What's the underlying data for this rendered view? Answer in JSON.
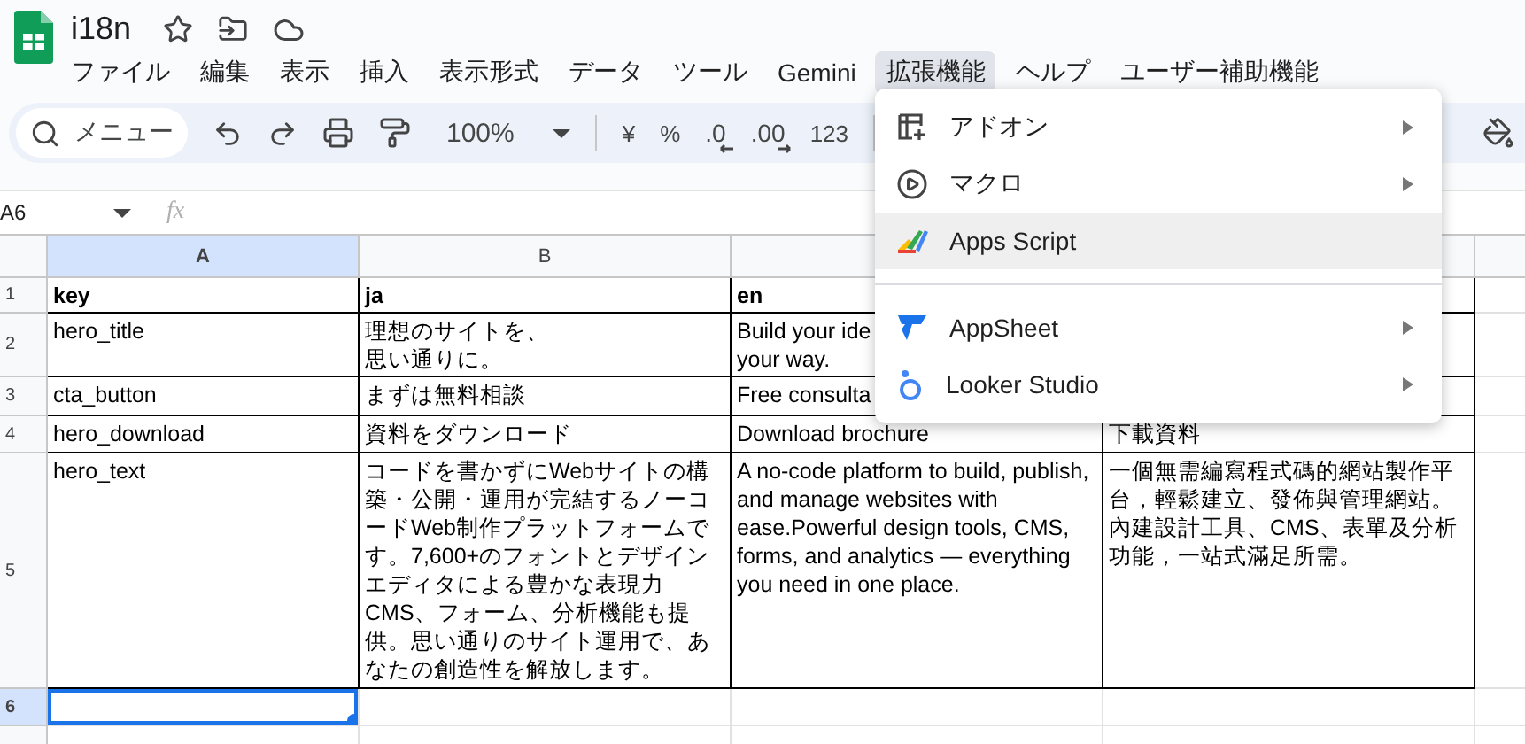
{
  "app": {
    "title": "i18n"
  },
  "menu_bar": [
    {
      "label": "ファイル",
      "selected": false
    },
    {
      "label": "編集",
      "selected": false
    },
    {
      "label": "表示",
      "selected": false
    },
    {
      "label": "挿入",
      "selected": false
    },
    {
      "label": "表示形式",
      "selected": false
    },
    {
      "label": "データ",
      "selected": false
    },
    {
      "label": "ツール",
      "selected": false
    },
    {
      "label": "Gemini",
      "selected": false
    },
    {
      "label": "拡張機能",
      "selected": true
    },
    {
      "label": "ヘルプ",
      "selected": false
    },
    {
      "label": "ユーザー補助機能",
      "selected": false
    }
  ],
  "toolbar": {
    "search": {
      "placeholder": "メニュー"
    },
    "zoom": "100%",
    "format_buttons": [
      {
        "label": "¥",
        "kind": "plain"
      },
      {
        "label": "%",
        "kind": "plain"
      },
      {
        "label": ".0",
        "kind": "decrease"
      },
      {
        "label": ".00",
        "kind": "increase"
      },
      {
        "label": "123",
        "kind": "plain"
      }
    ]
  },
  "name_box": "A6",
  "formula_label": "fx",
  "columns": [
    {
      "label": "A",
      "selected": true
    },
    {
      "label": "B",
      "selected": false
    },
    {
      "selected": false
    },
    {
      "selected": false
    }
  ],
  "rows": [
    {
      "number": "1",
      "bold": true,
      "selected": false,
      "cells": [
        "key",
        "ja",
        "en",
        null
      ]
    },
    {
      "number": "2",
      "bold": false,
      "selected": false,
      "cells": [
        "hero_title",
        [
          "理想のサイトを、",
          "思い通りに。"
        ],
        [
          "Build your ide",
          "your way."
        ],
        null
      ]
    },
    {
      "number": "3",
      "bold": false,
      "selected": false,
      "cells": [
        "cta_button",
        "まずは無料相談",
        "Free consulta",
        null
      ]
    },
    {
      "number": "4",
      "bold": false,
      "selected": false,
      "cells": [
        "hero_download",
        "資料をダウンロード",
        "Download brochure",
        "下載資料"
      ]
    },
    {
      "number": "5",
      "bold": false,
      "selected": false,
      "cells": [
        "hero_text",
        "コードを書かずにWebサイトの構築・公開・運用が完結するノーコードWeb制作プラットフォームです。7,600+のフォントとデザインエディタによる豊かな表現力CMS、フォーム、分析機能も提供。思い通りのサイト運用で、あなたの創造性を解放します。",
        "A no-code platform to build, publish, and manage websites with ease.Powerful design tools, CMS, forms, and analytics — everything you need in one place.",
        "一個無需編寫程式碼的網站製作平台，輕鬆建立、發佈與管理網站。內建設計工具、CMS、表單及分析功能，一站式滿足所需。"
      ]
    },
    {
      "number": "6",
      "bold": false,
      "selected": true,
      "cells": [
        null,
        null,
        null,
        null
      ]
    }
  ],
  "dropdown": {
    "groups": [
      [
        {
          "label": "アドオン",
          "kind": "addon",
          "submenu": true,
          "highlighted": false
        },
        {
          "label": "マクロ",
          "kind": "macro",
          "submenu": true,
          "highlighted": false
        },
        {
          "label": "Apps Script",
          "kind": "script",
          "submenu": false,
          "highlighted": true
        }
      ],
      [
        {
          "label": "AppSheet",
          "kind": "appsheet",
          "submenu": true,
          "highlighted": false
        },
        {
          "label": "Looker Studio",
          "kind": "looker",
          "submenu": true,
          "highlighted": false
        }
      ]
    ]
  }
}
